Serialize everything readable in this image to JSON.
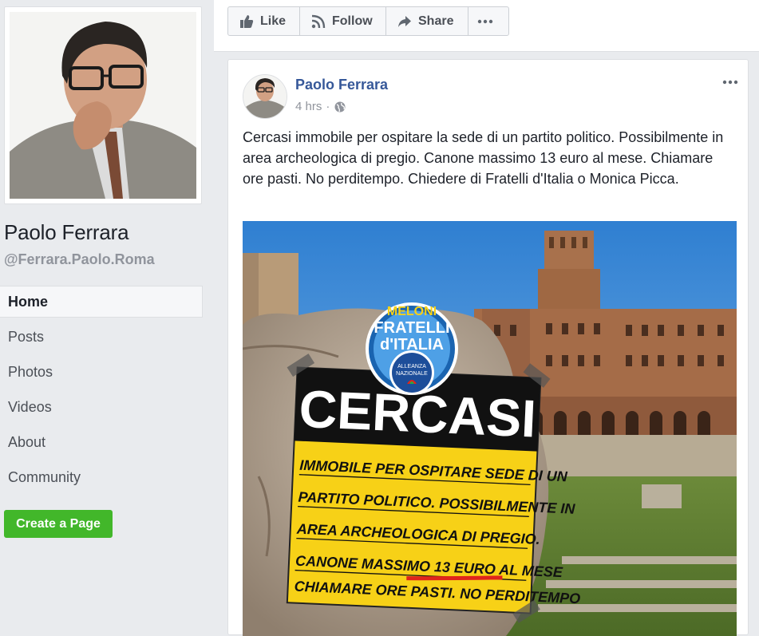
{
  "profile": {
    "name": "Paolo Ferrara",
    "handle": "@Ferrara.Paolo.Roma"
  },
  "nav": {
    "items": [
      {
        "label": "Home",
        "active": true
      },
      {
        "label": "Posts"
      },
      {
        "label": "Photos"
      },
      {
        "label": "Videos"
      },
      {
        "label": "About"
      },
      {
        "label": "Community"
      }
    ],
    "create_page_label": "Create a Page"
  },
  "actions": {
    "like": "Like",
    "follow": "Follow",
    "share": "Share"
  },
  "post": {
    "author": "Paolo Ferrara",
    "time": "4 hrs",
    "text": "Cercasi immobile per ospitare la sede di un partito politico. Possibilmente in area archeologica di pregio. Canone massimo 13 euro al mese. Chiamare ore pasti. No perditempo. Chiedere di Fratelli d'Italia o Monica Picca.",
    "image": {
      "logo_top": "MELONI",
      "logo_main_1": "FRATELLI",
      "logo_main_2": "d'ITALIA",
      "logo_sub_1": "ALLEANZA",
      "logo_sub_2": "NAZIONALE",
      "sign_title": "CERCASI",
      "sign_lines": [
        "IMMOBILE PER OSPITARE SEDE DI UN",
        "PARTITO POLITICO. POSSIBILMENTE IN",
        "AREA ARCHEOLOGICA DI PREGIO.",
        "CANONE MASSIMO 13 EURO AL MESE",
        "CHIAMARE ORE PASTI. NO PERDITEMPO"
      ]
    }
  },
  "colors": {
    "link_blue": "#365899",
    "green_button": "#42b72a",
    "background": "#e9ebee",
    "sign_yellow": "#f7d117"
  }
}
